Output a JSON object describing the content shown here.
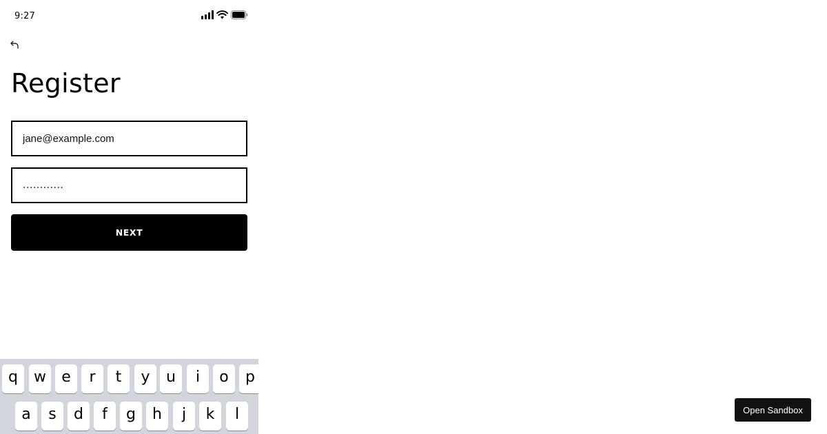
{
  "status_bar": {
    "time": "9:27",
    "icons": [
      "signal-icon",
      "wifi-icon",
      "battery-icon"
    ]
  },
  "header": {
    "back_icon": "back-arrow-icon",
    "title": "Register"
  },
  "form": {
    "email_value": "jane@example.com",
    "password_value": "............",
    "next_label": "NEXT"
  },
  "keyboard": {
    "row1": [
      "q",
      "w",
      "e",
      "r",
      "t",
      "y",
      "u",
      "i",
      "o",
      "p"
    ],
    "row2": [
      "a",
      "s",
      "d",
      "f",
      "g",
      "h",
      "j",
      "k",
      "l"
    ]
  },
  "sandbox": {
    "label": "Open Sandbox"
  },
  "colors": {
    "primary": "#000000",
    "background": "#ffffff",
    "keyboard_bg": "#d2d5db",
    "key_bg": "#ffffff",
    "sandbox_bg": "#111111"
  }
}
